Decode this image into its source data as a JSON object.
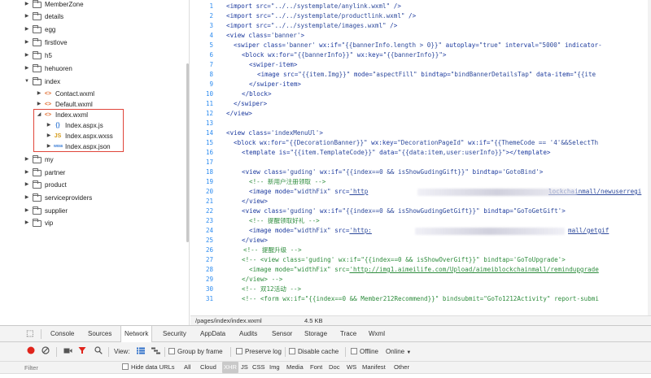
{
  "tree": {
    "folders_top": [
      "MemberZone",
      "details",
      "egg",
      "firstlove",
      "h5",
      "hehuoren"
    ],
    "index_folder": "index",
    "index_files": [
      "Contact.wxml",
      "Default.wxml"
    ],
    "selected_file": "Index.wxml",
    "selected_children": [
      {
        "icon": "{}",
        "name": "Index.aspx.js"
      },
      {
        "icon": "JS",
        "name": "Index.aspx.wxss"
      },
      {
        "icon": "wxss",
        "name": "Index.aspx.json"
      }
    ],
    "folders_bottom": [
      "my",
      "partner",
      "product",
      "serviceproviders",
      "supplier",
      "vip"
    ]
  },
  "editor": {
    "line_numbers": [
      "1",
      "2",
      "3",
      "4",
      "5",
      "6",
      "7",
      "8",
      "9",
      "10",
      "11",
      "12",
      "13",
      "14",
      "15",
      "16",
      "17",
      "18",
      "19",
      "20",
      "21",
      "22",
      "23",
      "24",
      "25",
      "26",
      "27",
      "28",
      "29",
      "30",
      "31"
    ]
  },
  "code": {
    "l1": [
      "<import src=",
      "\"../../systemplate/anylink.wxml\"",
      " />"
    ],
    "l2": [
      "<import src=",
      "\"../../systemplate/productlink.wxml\"",
      " />"
    ],
    "l3": [
      "<import src=",
      "\"../../systemplate/images.wxml\"",
      " />"
    ],
    "l4": [
      "<view class=",
      "'banner'",
      ">"
    ],
    "l5": [
      "<swiper class=",
      "'banner'",
      " wx:if=",
      "\"{{bannerInfo.length > 0}}\"",
      " autoplay=",
      "\"true\"",
      " interval=",
      "\"5000\"",
      " indicator-"
    ],
    "l6": [
      "<block wx:for=",
      "\"{{bannerInfo}}\"",
      " wx:key=",
      "\"{{bannerInfo}}\"",
      ">"
    ],
    "l7": [
      "<swiper-item>"
    ],
    "l8": [
      "<image src=",
      "\"{{item.Img}}\"",
      " mode=",
      "\"aspectFill\"",
      " bindtap=",
      "\"bindBannerDetailsTap\"",
      " data-item=",
      "\"{{ite"
    ],
    "l9": [
      "</swiper-item>"
    ],
    "l10": [
      "</block>"
    ],
    "l11": [
      "</swiper>"
    ],
    "l12": [
      "</view>"
    ],
    "l14": [
      "<view class=",
      "'indexMenuUl'",
      ">"
    ],
    "l15": [
      "<block wx:for=",
      "\"{{DecorationBanner}}\"",
      " wx:key=",
      "\"DecorationPageId\"",
      " wx:if=",
      "\"{{ThemeCode == '4'&&SelectTh"
    ],
    "l16": [
      "<template is=",
      "\"{{item.TemplateCode}}\"",
      " data=",
      "\"{{data:item,user:userInfo}}\"",
      "></template>"
    ],
    "l18": [
      "<view class=",
      "'guding'",
      " wx:if=",
      "\"{{index==0 && isShowGudingGift}}\"",
      " bindtap=",
      "'GotoBind'",
      ">"
    ],
    "l19": [
      "<!-- 新用户注册领取 -->"
    ],
    "l20": [
      "<image mode=",
      "\"widthFix\"",
      " src=",
      "'http",
      "lockchainmall/newuserregi"
    ],
    "l21": [
      "</view>"
    ],
    "l22": [
      "<view class=",
      "'guding'",
      " wx:if=",
      "\"{{index==0 && isShowGudingGetGift}}\"",
      " bindtap=",
      "\"GoToGetGift'",
      ">"
    ],
    "l23": [
      "<!-- 提醒领取好礼 -->"
    ],
    "l24": [
      "<image mode=",
      "\"widthFix\"",
      " src=",
      "'http:",
      "mall/getgif"
    ],
    "l25": [
      "</view>"
    ],
    "l26": [
      "<!-- 提醒升级 -->"
    ],
    "l27": [
      "<!-- <view class=",
      "'guding'",
      " wx:if=",
      "\"{{index==0 && isShowOverGift}}\"",
      " bindtap=",
      "'GoToUpgrade'",
      ">"
    ],
    "l28": [
      "<image mode=",
      "\"widthFix\"",
      " src=",
      "'http://img1.aimeilife.com/Upload/aimeiblockchainmall/remindupgrade"
    ],
    "l29": [
      "</view> -->"
    ],
    "l30": [
      "<!-- 双12活动 -->"
    ],
    "l31": [
      "<!-- <form wx:if=",
      "\"{{index==0 && Member212Recommend}}\"",
      " bindsubmit=",
      "\"GoTo1212Activity\"",
      " report-submi"
    ]
  },
  "statusbar": {
    "path": "/pages/index/index.wxml",
    "size": "4.5 KB"
  },
  "devtools": {
    "tabs": [
      "Console",
      "Sources",
      "Network",
      "Security",
      "AppData",
      "Audits",
      "Sensor",
      "Storage",
      "Trace",
      "Wxml"
    ],
    "active_tab": "Network",
    "toolbar": {
      "view_label": "View:",
      "group_by_frame": "Group by frame",
      "preserve_log": "Preserve log",
      "disable_cache": "Disable cache",
      "offline": "Offline",
      "throttle": "Online"
    },
    "filter": {
      "placeholder": "Filter",
      "hide_data_urls": "Hide data URLs",
      "types": [
        "All",
        "Cloud",
        "XHR",
        "JS",
        "CSS",
        "Img",
        "Media",
        "Font",
        "Doc",
        "WS",
        "Manifest",
        "Other"
      ]
    }
  },
  "colors": {
    "line_number": "#2d8cf0",
    "keyword": "#1c3a9e",
    "comment": "#2f8d3e",
    "highlight_border": "#e0453a",
    "record_button": "#e0241b"
  }
}
